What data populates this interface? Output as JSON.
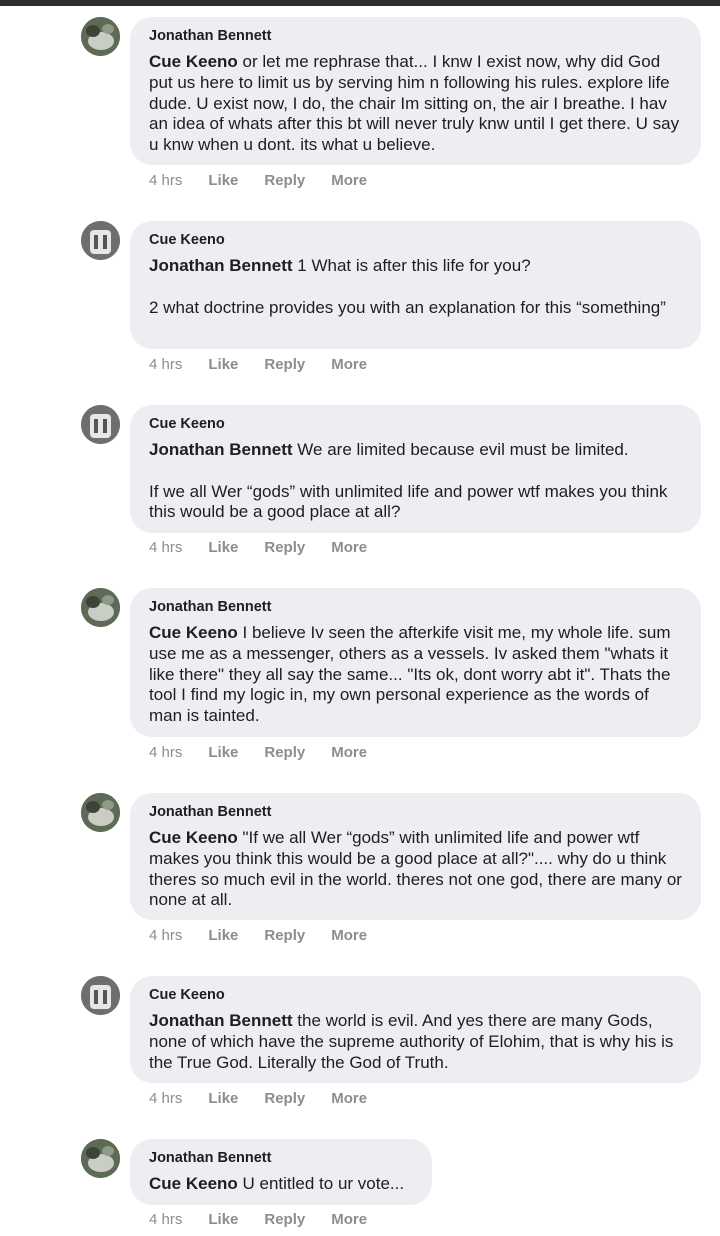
{
  "comments": [
    {
      "author": "Jonathan Bennett",
      "mention": "Cue Keeno",
      "text": " or let me rephrase that... I knw I exist now, why did God put us here to limit us by serving him n following his rules. explore life dude. U exist now, I do, the chair Im sitting on, the air I breathe. I hav an idea of whats after this bt will never truly knw until I get there. U say u knw when u dont. its what u believe.",
      "time": "4 hrs",
      "like": "Like",
      "reply": "Reply",
      "more": "More"
    },
    {
      "author": "Cue Keeno",
      "mention": "Jonathan Bennett",
      "text": " 1 What is after this life for you?\n\n2 what doctrine provides you with an explanation for this “something”",
      "time": "4 hrs",
      "like": "Like",
      "reply": "Reply",
      "more": "More"
    },
    {
      "author": "Cue Keeno",
      "mention": "Jonathan Bennett",
      "text": " We are limited because evil must be limited.\n\nIf we all Wer “gods” with unlimited life and power wtf makes you think this would be a good place at all?",
      "time": "4 hrs",
      "like": "Like",
      "reply": "Reply",
      "more": "More"
    },
    {
      "author": "Jonathan Bennett",
      "mention": "Cue Keeno",
      "text": " I believe Iv seen the afterkife visit me, my whole life. sum use me as a messenger, others as a vessels. Iv asked them \"whats it like there\" they all say the same... \"Its ok, dont worry abt it\". Thats the tool I find my logic in, my own personal experience as the words of man is tainted.",
      "time": "4 hrs",
      "like": "Like",
      "reply": "Reply",
      "more": "More"
    },
    {
      "author": "Jonathan Bennett",
      "mention": "Cue Keeno",
      "text": " \"If we all Wer “gods” with unlimited life and power wtf makes you think this would be a good place at all?\".... why do u think theres so much evil in the world. theres not one god, there are many or none at all.",
      "time": "4 hrs",
      "like": "Like",
      "reply": "Reply",
      "more": "More"
    },
    {
      "author": "Cue Keeno",
      "mention": "Jonathan Bennett",
      "text": " the world is evil. And yes there are many Gods, none of which have the supreme authority of Elohim, that is why his is the True God. Literally the God of Truth.",
      "time": "4 hrs",
      "like": "Like",
      "reply": "Reply",
      "more": "More"
    },
    {
      "author": "Jonathan Bennett",
      "mention": "Cue Keeno",
      "text": " U entitled to ur vote...",
      "time": "4 hrs",
      "like": "Like",
      "reply": "Reply",
      "more": "More"
    }
  ]
}
